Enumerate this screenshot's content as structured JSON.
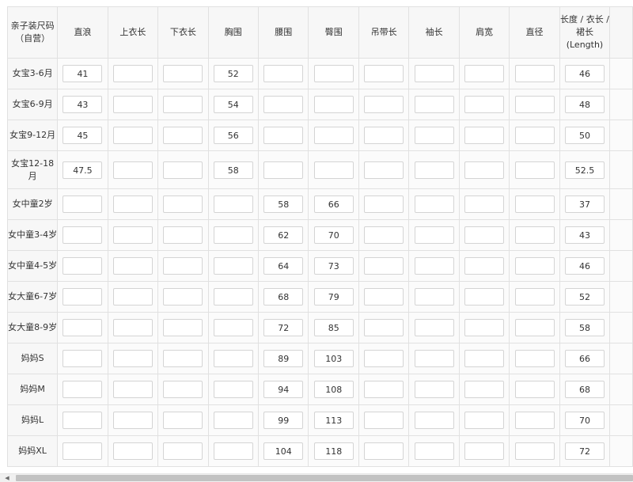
{
  "headers": [
    "亲子装尺码（自营）",
    "直浪",
    "上衣长",
    "下衣长",
    "胸围",
    "腰围",
    "臀围",
    "吊带长",
    "袖长",
    "肩宽",
    "直径",
    "长度 / 衣长 / 裙长 (Length)",
    ""
  ],
  "rows": [
    {
      "label": "女宝3-6月",
      "values": [
        "41",
        "",
        "",
        "52",
        "",
        "",
        "",
        "",
        "",
        "",
        "46",
        ""
      ]
    },
    {
      "label": "女宝6-9月",
      "values": [
        "43",
        "",
        "",
        "54",
        "",
        "",
        "",
        "",
        "",
        "",
        "48",
        ""
      ]
    },
    {
      "label": "女宝9-12月",
      "values": [
        "45",
        "",
        "",
        "56",
        "",
        "",
        "",
        "",
        "",
        "",
        "50",
        ""
      ]
    },
    {
      "label": "女宝12-18月",
      "values": [
        "47.5",
        "",
        "",
        "58",
        "",
        "",
        "",
        "",
        "",
        "",
        "52.5",
        ""
      ]
    },
    {
      "label": "女中童2岁",
      "values": [
        "",
        "",
        "",
        "",
        "58",
        "66",
        "",
        "",
        "",
        "",
        "37",
        ""
      ]
    },
    {
      "label": "女中童3-4岁",
      "values": [
        "",
        "",
        "",
        "",
        "62",
        "70",
        "",
        "",
        "",
        "",
        "43",
        ""
      ]
    },
    {
      "label": "女中童4-5岁",
      "values": [
        "",
        "",
        "",
        "",
        "64",
        "73",
        "",
        "",
        "",
        "",
        "46",
        ""
      ]
    },
    {
      "label": "女大童6-7岁",
      "values": [
        "",
        "",
        "",
        "",
        "68",
        "79",
        "",
        "",
        "",
        "",
        "52",
        ""
      ]
    },
    {
      "label": "女大童8-9岁",
      "values": [
        "",
        "",
        "",
        "",
        "72",
        "85",
        "",
        "",
        "",
        "",
        "58",
        ""
      ]
    },
    {
      "label": "妈妈S",
      "values": [
        "",
        "",
        "",
        "",
        "89",
        "103",
        "",
        "",
        "",
        "",
        "66",
        ""
      ]
    },
    {
      "label": "妈妈M",
      "values": [
        "",
        "",
        "",
        "",
        "94",
        "108",
        "",
        "",
        "",
        "",
        "68",
        ""
      ]
    },
    {
      "label": "妈妈L",
      "values": [
        "",
        "",
        "",
        "",
        "99",
        "113",
        "",
        "",
        "",
        "",
        "70",
        ""
      ]
    },
    {
      "label": "妈妈XL",
      "values": [
        "",
        "",
        "",
        "",
        "104",
        "118",
        "",
        "",
        "",
        "",
        "72",
        ""
      ]
    }
  ],
  "scrollbar": {
    "left_arrow": "◀"
  }
}
